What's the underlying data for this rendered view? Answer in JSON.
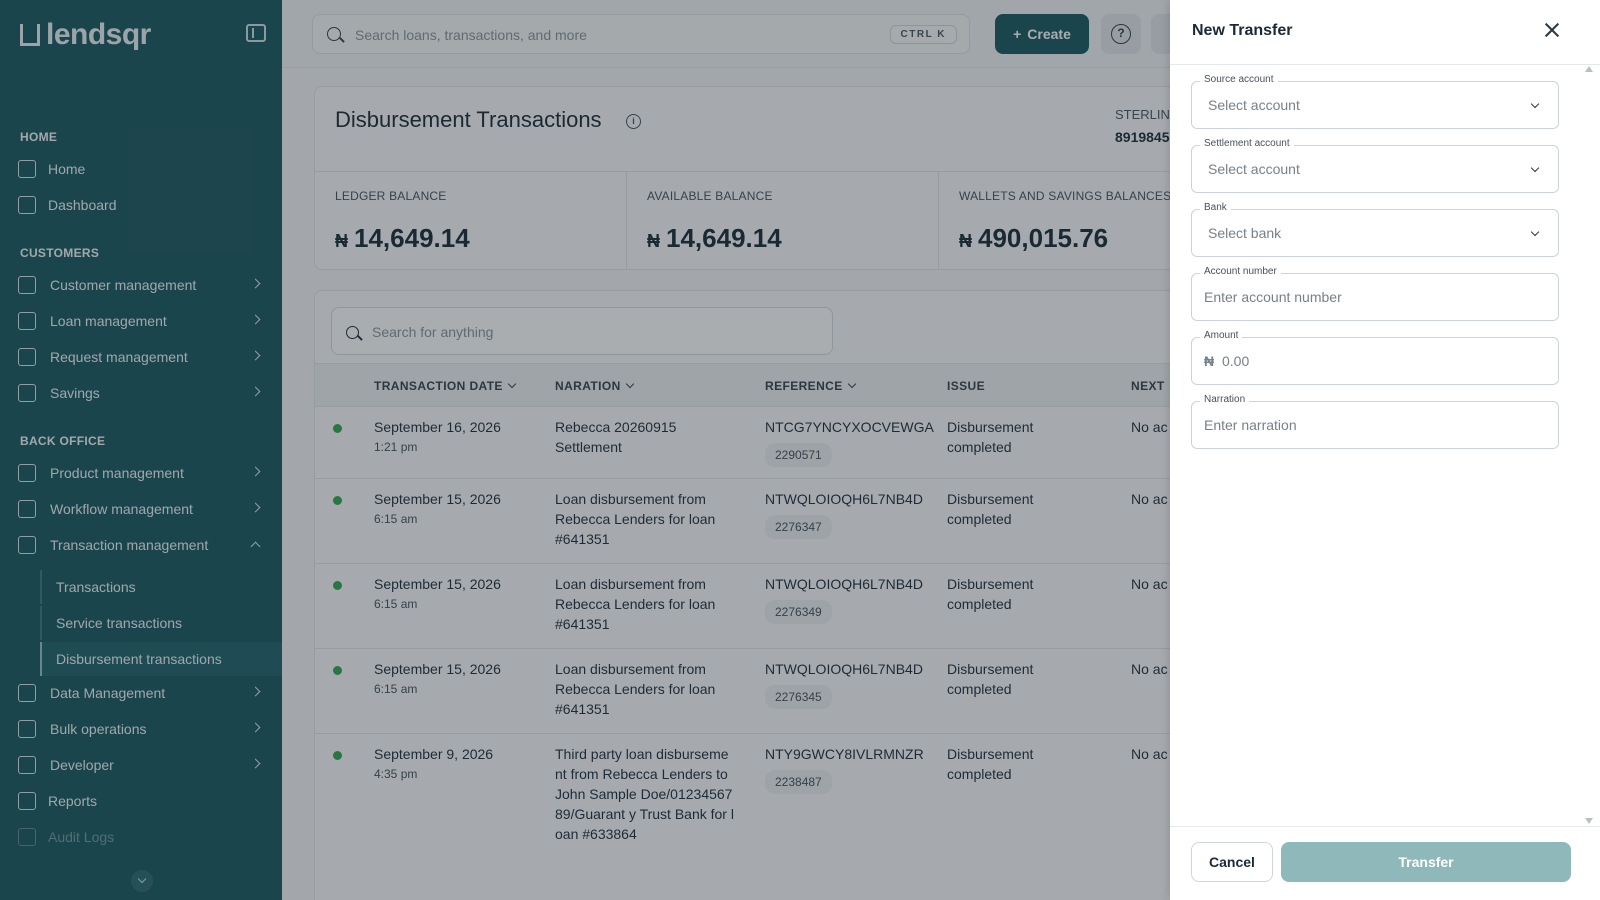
{
  "app": {
    "logo_text": "lendsqr"
  },
  "sidebar": {
    "sections": [
      {
        "label": "HOME"
      },
      {
        "label": "CUSTOMERS"
      },
      {
        "label": "BACK OFFICE"
      }
    ],
    "items": [
      {
        "label": "Home",
        "icon": "home-icon"
      },
      {
        "label": "Dashboard",
        "icon": "dashboard-icon"
      },
      {
        "label": "Customer management",
        "icon": "users-icon"
      },
      {
        "label": "Loan management",
        "icon": "cash-icon"
      },
      {
        "label": "Request management",
        "icon": "inbox-icon"
      },
      {
        "label": "Savings",
        "icon": "bank-icon"
      },
      {
        "label": "Product management",
        "icon": "box-icon"
      },
      {
        "label": "Workflow management",
        "icon": "workflow-icon"
      },
      {
        "label": "Transaction management",
        "icon": "transfer-icon"
      },
      {
        "label": "Data Management",
        "icon": "chart-icon"
      },
      {
        "label": "Bulk operations",
        "icon": "inbox-icon"
      },
      {
        "label": "Developer",
        "icon": "code-icon"
      },
      {
        "label": "Reports",
        "icon": "bar-chart-icon"
      },
      {
        "label": "Audit Logs",
        "icon": "clipboard-icon"
      }
    ],
    "sub_items": [
      {
        "label": "Transactions"
      },
      {
        "label": "Service transactions"
      },
      {
        "label": "Disbursement transactions"
      }
    ]
  },
  "topbar": {
    "search_placeholder": "Search loans, transactions, and more",
    "shortcut": "CTRL K",
    "create_label": "Create",
    "help_glyph": "?"
  },
  "main": {
    "title": "Disbursement Transactions",
    "bank_name": "STERLING",
    "bank_account": "8919845",
    "balances": [
      {
        "label": "LEDGER BALANCE",
        "currency": "₦",
        "amount": "14,649.14"
      },
      {
        "label": "AVAILABLE BALANCE",
        "currency": "₦",
        "amount": "14,649.14"
      },
      {
        "label": "WALLETS AND SAVINGS BALANCES",
        "currency": "₦",
        "amount": "490,015.76"
      }
    ],
    "table_search_placeholder": "Search for anything",
    "columns": [
      "TRANSACTION DATE",
      "NARATION",
      "REFERENCE",
      "ISSUE",
      "NEXT"
    ],
    "rows": [
      {
        "date": "September 16, 2026",
        "time": "1:21 pm",
        "narration": "Rebecca 20260915 Settlement",
        "reference": "NTCG7YNCYXOCVEWGA",
        "ref_id": "2290571",
        "issue": "Disbursement completed",
        "next": "No ac"
      },
      {
        "date": "September 15, 2026",
        "time": "6:15 am",
        "narration": "Loan disbursement from Rebecca Lenders for loan #641351",
        "reference": "NTWQLOIOQH6L7NB4D",
        "ref_id": "2276347",
        "issue": "Disbursement completed",
        "next": "No ac"
      },
      {
        "date": "September 15, 2026",
        "time": "6:15 am",
        "narration": "Loan disbursement from Rebecca Lenders for loan #641351",
        "reference": "NTWQLOIOQH6L7NB4D",
        "ref_id": "2276349",
        "issue": "Disbursement completed",
        "next": "No ac"
      },
      {
        "date": "September 15, 2026",
        "time": "6:15 am",
        "narration": "Loan disbursement from Rebecca Lenders for loan #641351",
        "reference": "NTWQLOIOQH6L7NB4D",
        "ref_id": "2276345",
        "issue": "Disbursement completed",
        "next": "No ac"
      },
      {
        "date": "September 9, 2026",
        "time": "4:35 pm",
        "narration": "Third party loan disbursement from Rebecca Lenders to John Sample Doe/0123456789/Guarant y Trust Bank for loan #633864",
        "reference": "NTY9GWCY8IVLRMNZR",
        "ref_id": "2238487",
        "issue": "Disbursement completed",
        "next": "No ac"
      }
    ]
  },
  "drawer": {
    "title": "New Transfer",
    "fields": [
      {
        "label": "Source account",
        "value": "Select account"
      },
      {
        "label": "Settlement account",
        "value": "Select account"
      },
      {
        "label": "Bank",
        "value": "Select bank"
      },
      {
        "label": "Account number",
        "value": "Enter account number"
      },
      {
        "label": "Amount",
        "currency": "₦",
        "value": "0.00"
      },
      {
        "label": "Narration",
        "value": "Enter narration"
      }
    ],
    "cancel_label": "Cancel",
    "transfer_label": "Transfer"
  },
  "colors": {
    "sidebar_bg": "#1a5760",
    "accent": "#1a5760",
    "status_success": "#2fa84f",
    "transfer_disabled": "#8fb8ba"
  }
}
